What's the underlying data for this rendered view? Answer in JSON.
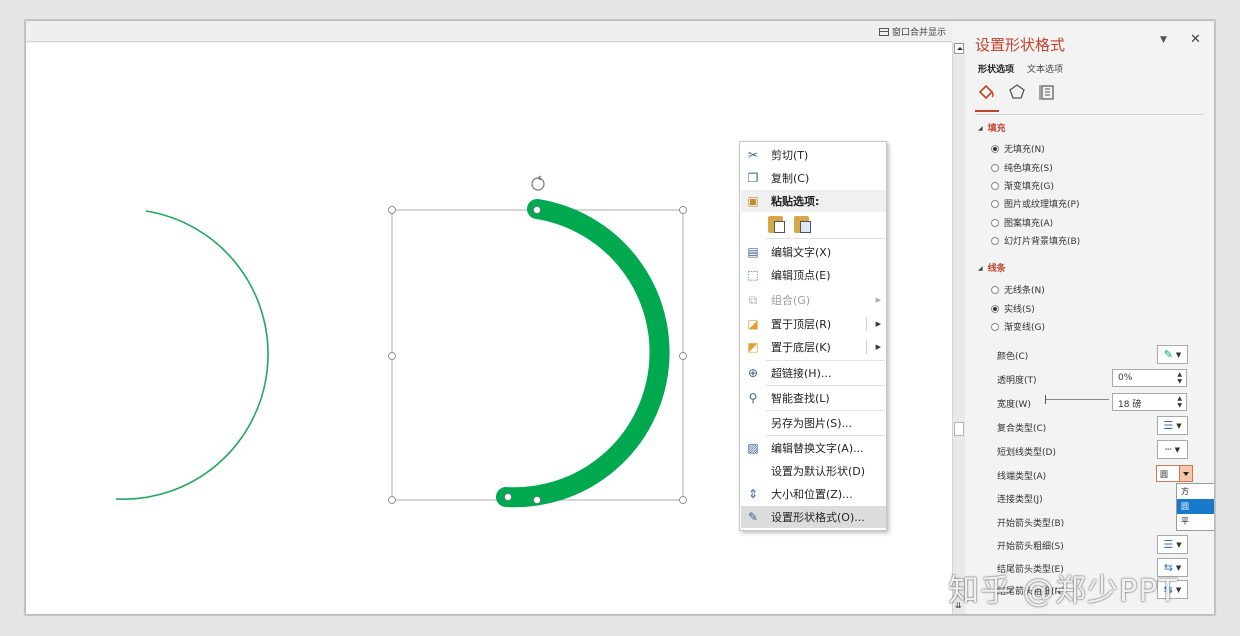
{
  "topbar": {
    "merge_label": "窗口合并显示"
  },
  "context_menu": {
    "items": [
      {
        "label": "剪切(T)",
        "icon": "scissors-icon",
        "enabled": true
      },
      {
        "label": "复制(C)",
        "icon": "copy-icon",
        "enabled": true
      },
      {
        "label": "粘贴选项:",
        "icon": "paste-icon",
        "enabled": true
      },
      {
        "label": "编辑文字(X)",
        "icon": "edit-text-icon",
        "enabled": true
      },
      {
        "label": "编辑顶点(E)",
        "icon": "edit-points-icon",
        "enabled": true
      },
      {
        "label": "组合(G)",
        "icon": "group-icon",
        "enabled": false
      },
      {
        "label": "置于顶层(R)",
        "icon": "bring-front-icon",
        "enabled": true
      },
      {
        "label": "置于底层(K)",
        "icon": "send-back-icon",
        "enabled": true
      },
      {
        "label": "超链接(H)...",
        "icon": "hyperlink-icon",
        "enabled": true
      },
      {
        "label": "智能查找(L)",
        "icon": "smart-lookup-icon",
        "enabled": true
      },
      {
        "label": "另存为图片(S)...",
        "icon": "",
        "enabled": true
      },
      {
        "label": "编辑替换文字(A)...",
        "icon": "alt-text-icon",
        "enabled": true
      },
      {
        "label": "设置为默认形状(D)",
        "icon": "",
        "enabled": true
      },
      {
        "label": "大小和位置(Z)...",
        "icon": "size-position-icon",
        "enabled": true
      },
      {
        "label": "设置形状格式(O)...",
        "icon": "format-shape-icon",
        "enabled": true,
        "highlighted": true
      }
    ]
  },
  "pane": {
    "title": "设置形状格式",
    "tabs": {
      "shape": "形状选项",
      "text": "文本选项"
    },
    "fill": {
      "header": "填充",
      "options": [
        "无填充(N)",
        "纯色填充(S)",
        "渐变填充(G)",
        "图片或纹理填充(P)",
        "图案填充(A)",
        "幻灯片背景填充(B)"
      ],
      "selected": 0
    },
    "line": {
      "header": "线条",
      "options": [
        "无线条(N)",
        "实线(S)",
        "渐变线(G)"
      ],
      "selected": 1,
      "props": {
        "color": "颜色(C)",
        "transparency": "透明度(T)",
        "transparency_value": "0%",
        "width": "宽度(W)",
        "width_value": "18 磅",
        "compound": "复合类型(C)",
        "dash": "短划线类型(D)",
        "cap": "线端类型(A)",
        "cap_value": "圆",
        "join": "连接类型(J)",
        "begin_arrow_type": "开始箭头类型(B)",
        "begin_arrow_size": "开始箭头粗细(S)",
        "end_arrow_type": "结尾箭头类型(E)",
        "end_arrow_size": "结尾箭头粗细(N)"
      },
      "cap_options": [
        "方",
        "圆",
        "平"
      ],
      "cap_selected": 1
    }
  },
  "watermark": "知乎 @郑少PPT",
  "colors": {
    "accent": "#c0442a",
    "arc_green": "#00a84f",
    "selection_blue": "#1979ca"
  }
}
